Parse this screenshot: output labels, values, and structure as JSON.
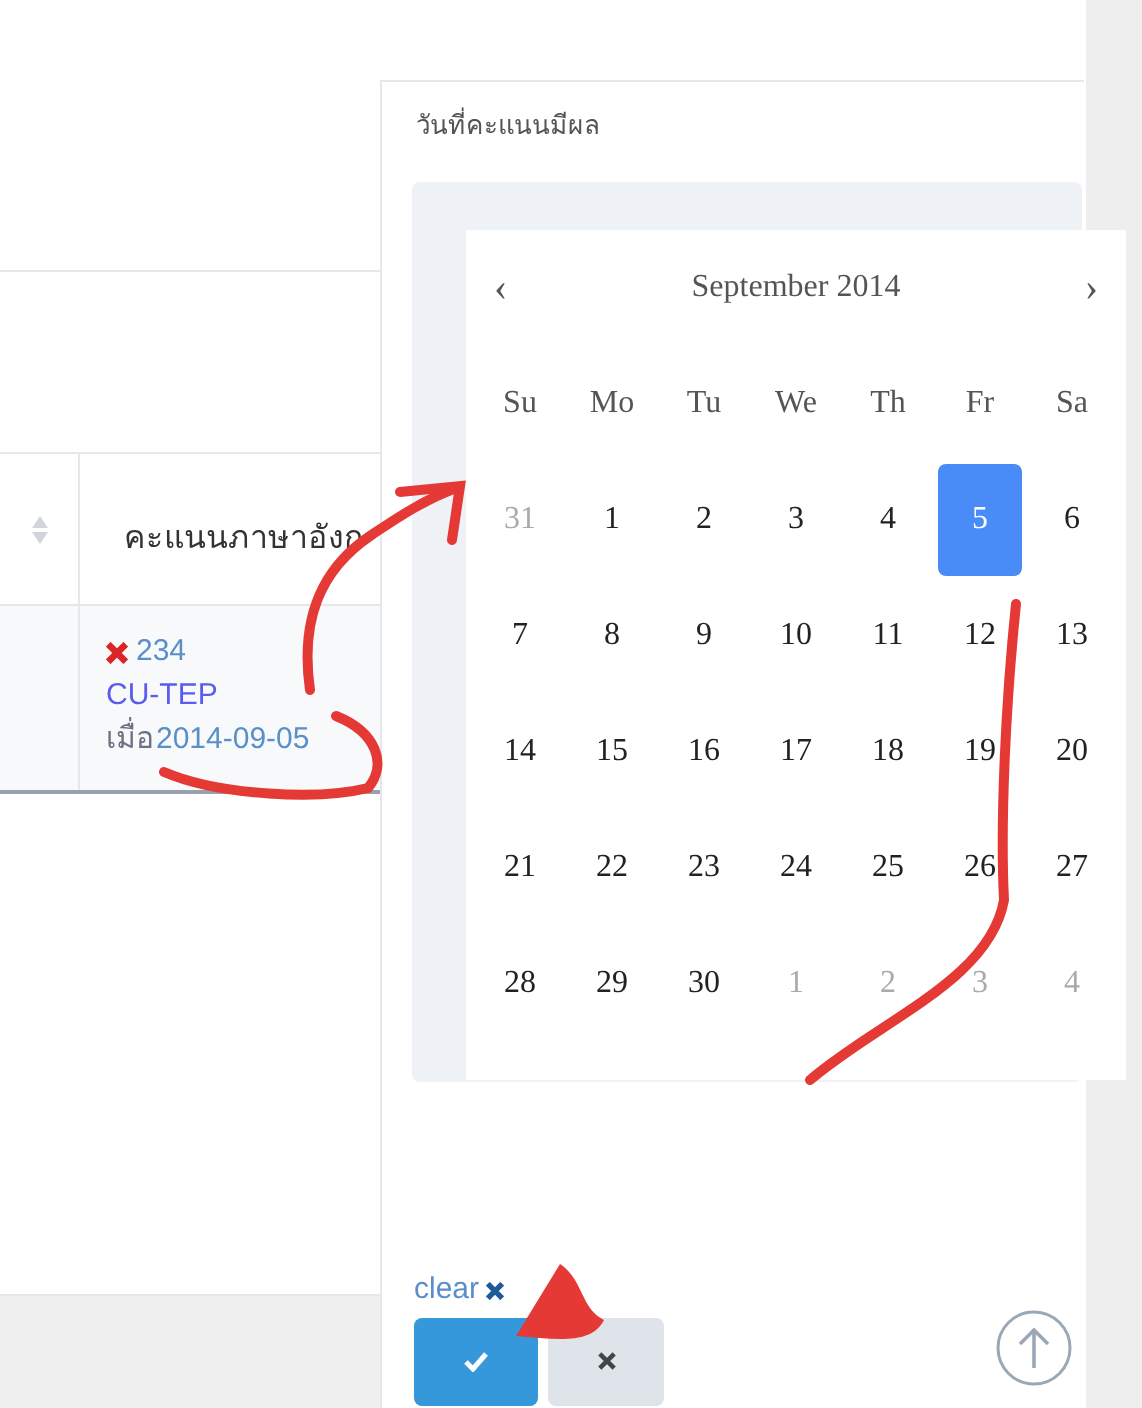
{
  "table": {
    "column_header": "คะแนนภาษาอังก",
    "cell": {
      "score": "234",
      "test": "CU-TEP",
      "date_prefix": "เมื่อ",
      "date": "2014-09-05"
    }
  },
  "panel": {
    "label": "วันที่คะแนนมีผล"
  },
  "calendar": {
    "prev": "‹",
    "title": "September 2014",
    "next": "›",
    "weekdays": [
      "Su",
      "Mo",
      "Tu",
      "We",
      "Th",
      "Fr",
      "Sa"
    ],
    "weeks": [
      [
        {
          "day": "31",
          "other_month": true,
          "selected": false
        },
        {
          "day": "1",
          "other_month": false,
          "selected": false
        },
        {
          "day": "2",
          "other_month": false,
          "selected": false
        },
        {
          "day": "3",
          "other_month": false,
          "selected": false
        },
        {
          "day": "4",
          "other_month": false,
          "selected": false
        },
        {
          "day": "5",
          "other_month": false,
          "selected": true
        },
        {
          "day": "6",
          "other_month": false,
          "selected": false
        }
      ],
      [
        {
          "day": "7",
          "other_month": false,
          "selected": false
        },
        {
          "day": "8",
          "other_month": false,
          "selected": false
        },
        {
          "day": "9",
          "other_month": false,
          "selected": false
        },
        {
          "day": "10",
          "other_month": false,
          "selected": false
        },
        {
          "day": "11",
          "other_month": false,
          "selected": false
        },
        {
          "day": "12",
          "other_month": false,
          "selected": false
        },
        {
          "day": "13",
          "other_month": false,
          "selected": false
        }
      ],
      [
        {
          "day": "14",
          "other_month": false,
          "selected": false
        },
        {
          "day": "15",
          "other_month": false,
          "selected": false
        },
        {
          "day": "16",
          "other_month": false,
          "selected": false
        },
        {
          "day": "17",
          "other_month": false,
          "selected": false
        },
        {
          "day": "18",
          "other_month": false,
          "selected": false
        },
        {
          "day": "19",
          "other_month": false,
          "selected": false
        },
        {
          "day": "20",
          "other_month": false,
          "selected": false
        }
      ],
      [
        {
          "day": "21",
          "other_month": false,
          "selected": false
        },
        {
          "day": "22",
          "other_month": false,
          "selected": false
        },
        {
          "day": "23",
          "other_month": false,
          "selected": false
        },
        {
          "day": "24",
          "other_month": false,
          "selected": false
        },
        {
          "day": "25",
          "other_month": false,
          "selected": false
        },
        {
          "day": "26",
          "other_month": false,
          "selected": false
        },
        {
          "day": "27",
          "other_month": false,
          "selected": false
        }
      ],
      [
        {
          "day": "28",
          "other_month": false,
          "selected": false
        },
        {
          "day": "29",
          "other_month": false,
          "selected": false
        },
        {
          "day": "30",
          "other_month": false,
          "selected": false
        },
        {
          "day": "1",
          "other_month": true,
          "selected": false
        },
        {
          "day": "2",
          "other_month": true,
          "selected": false
        },
        {
          "day": "3",
          "other_month": true,
          "selected": false
        },
        {
          "day": "4",
          "other_month": true,
          "selected": false
        }
      ]
    ]
  },
  "clear": "clear"
}
